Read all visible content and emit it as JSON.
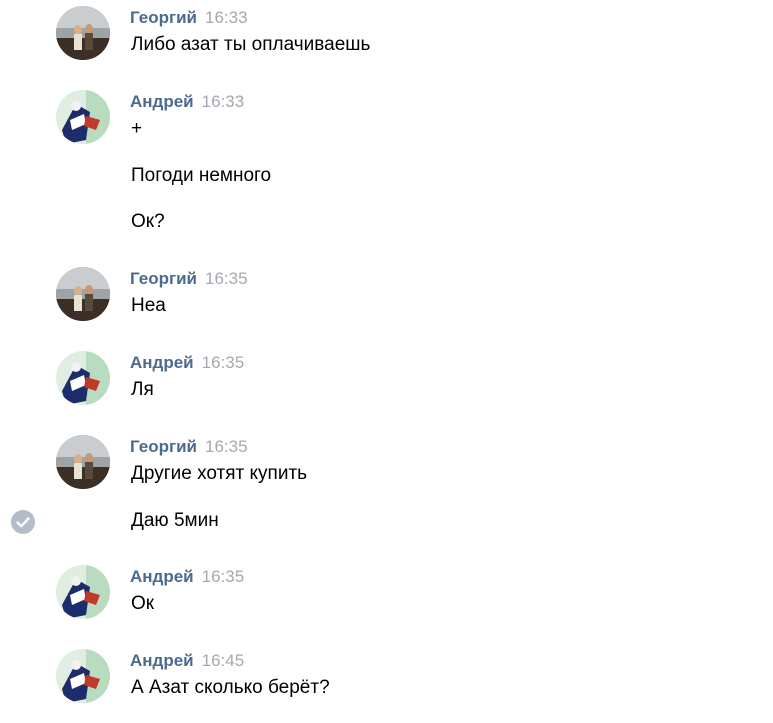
{
  "colors": {
    "author": "#4a6b8e",
    "time": "#a4a9b0",
    "text": "#000000",
    "check": "#b3bdc9"
  },
  "messages": [
    {
      "author": "Георгий",
      "time": "16:33",
      "avatar_icon": "user-photo-icon",
      "lines": [
        "Либо азат ты оплачиваешь"
      ]
    },
    {
      "author": "Андрей",
      "time": "16:33",
      "avatar_icon": "user-photo-icon",
      "lines": [
        "+",
        "Погоди немного",
        "Ок?"
      ]
    },
    {
      "author": "Георгий",
      "time": "16:35",
      "avatar_icon": "user-photo-icon",
      "lines": [
        "Неа"
      ]
    },
    {
      "author": "Андрей",
      "time": "16:35",
      "avatar_icon": "user-photo-icon",
      "lines": [
        "Ля"
      ]
    },
    {
      "author": "Георгий",
      "time": "16:35",
      "avatar_icon": "user-photo-icon",
      "lines": [
        "Другие хотят купить",
        "Даю 5мин"
      ]
    },
    {
      "author": "Андрей",
      "time": "16:35",
      "avatar_icon": "user-photo-icon",
      "lines": [
        "Ок"
      ]
    },
    {
      "author": "Андрей",
      "time": "16:45",
      "avatar_icon": "user-photo-icon",
      "lines": [
        "А Азат сколько берёт?"
      ]
    }
  ]
}
